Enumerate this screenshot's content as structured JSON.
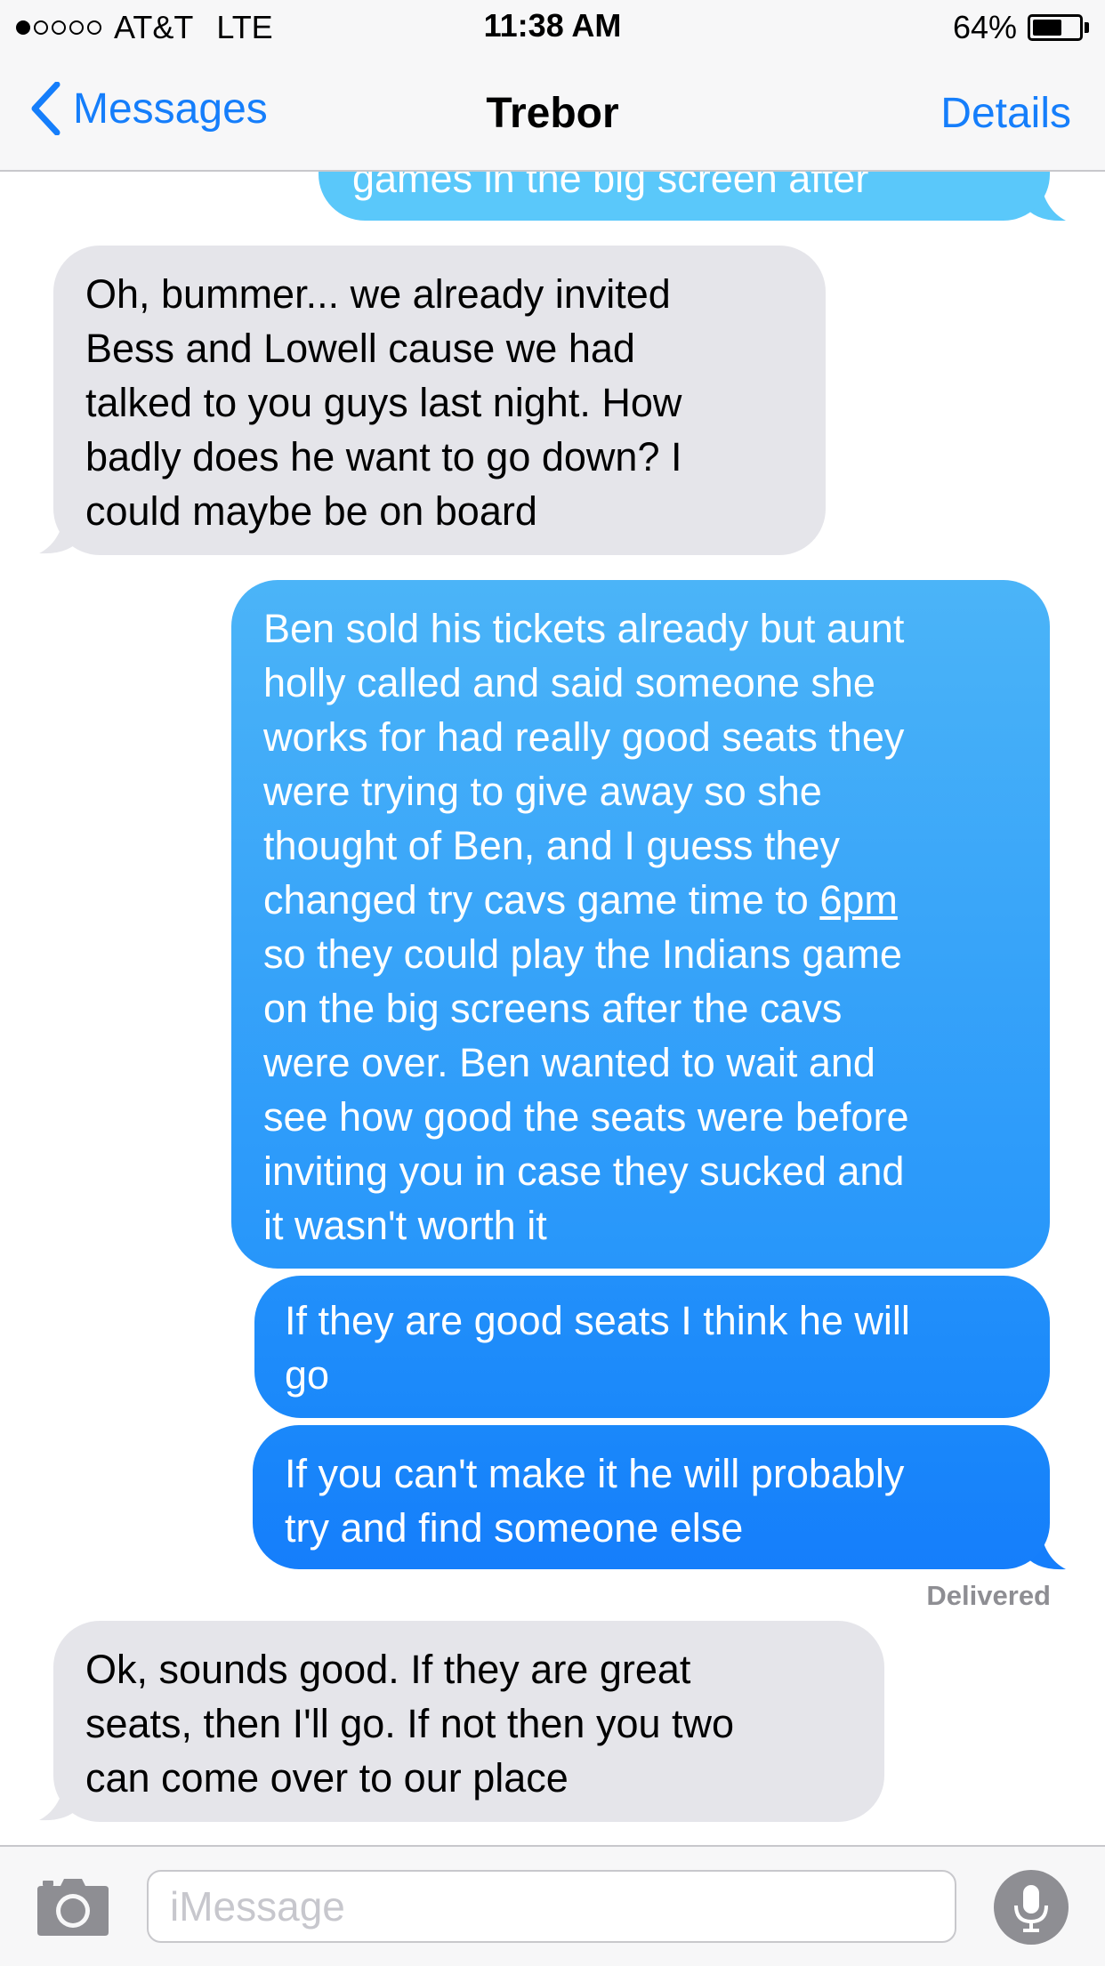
{
  "status_bar": {
    "carrier": "AT&T",
    "network": "LTE",
    "time": "11:38 AM",
    "battery_percent": "64%",
    "battery_level": 0.64,
    "signal_bars": 1
  },
  "nav": {
    "back_label": "Messages",
    "title": "Trebor",
    "details_label": "Details"
  },
  "messages": [
    {
      "id": "m0",
      "direction": "out",
      "lines": [
        "games in the big screen after"
      ]
    },
    {
      "id": "m1",
      "direction": "in",
      "lines": [
        "Oh, bummer... we already invited",
        "Bess and Lowell cause we had",
        "talked to you guys last night. How",
        "badly does he want to go down? I",
        "could maybe be on board"
      ]
    },
    {
      "id": "m2",
      "direction": "out",
      "lines": [
        "Ben sold his tickets already but aunt",
        "holly called and said someone she",
        "works for had really good seats they",
        "were trying to give away so she",
        "thought of Ben, and I guess they",
        "changed try cavs game time to ",
        "so they could play the Indians game",
        "on the big screens after the cavs",
        "were over. Ben wanted to wait and",
        "see how good the seats were before",
        "inviting you in case they sucked and",
        "it wasn't worth it"
      ],
      "link_text": "6pm"
    },
    {
      "id": "m3",
      "direction": "out",
      "lines": [
        "If they are good seats I think he will",
        "go"
      ]
    },
    {
      "id": "m4",
      "direction": "out",
      "lines": [
        "If you can't make it he will probably",
        "try and find someone else"
      ]
    },
    {
      "id": "m5",
      "direction": "in",
      "lines": [
        "Ok, sounds good. If they are great",
        "seats, then I'll go. If not then you two",
        "can come over to our place"
      ]
    }
  ],
  "delivered_label": "Delivered",
  "input": {
    "placeholder": "iMessage"
  },
  "icons": {
    "back": "chevron-left-icon",
    "camera": "camera-icon",
    "mic": "microphone-icon"
  },
  "colors": {
    "accent": "#157efb",
    "incoming_bubble": "#e5e5ea",
    "outgoing_top": "#5ac8fa",
    "outgoing_bottom": "#157efb"
  }
}
